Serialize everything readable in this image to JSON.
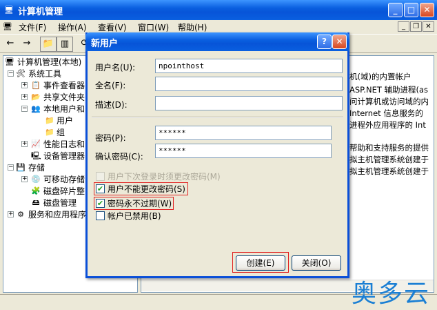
{
  "main_window": {
    "title": "计算机管理",
    "buttons": {
      "minimize": "_",
      "maximize": "□",
      "close": "✕"
    }
  },
  "menu": [
    "文件(F)",
    "操作(A)",
    "查看(V)",
    "窗口(W)",
    "帮助(H)"
  ],
  "mdi_buttons": {
    "minimize": "_",
    "restore": "❐",
    "close": "✕"
  },
  "tree": {
    "root": "计算机管理(本地)",
    "system_tools": "系统工具",
    "event_viewer": "事件查看器",
    "shared_folders": "共享文件夹",
    "local_users": "本地用户和",
    "users": "用户",
    "groups": "组",
    "perf_logs": "性能日志和",
    "device_manager": "设备管理器",
    "storage": "存储",
    "removable": "可移动存储",
    "defrag": "磁盘碎片整",
    "disk_mgmt": "磁盘管理",
    "services": "服务和应用程序"
  },
  "right_pane": {
    "descriptions": [
      "机(域)的内置帐户",
      " ASP.NET 辅助进程(as",
      "问计算机或访问域的内",
      " Internet 信息服务的",
      "进程外应用程序的 Int",
      "帮助和支持服务的提供",
      "拟主机管理系统创建于",
      "拟主机管理系统创建于"
    ]
  },
  "watermark": "奥多云",
  "dialog": {
    "title": "新用户",
    "help_btn": "?",
    "close_btn": "✕",
    "username_label": "用户名(U):",
    "username_value": "npointhost",
    "fullname_label": "全名(F):",
    "fullname_value": "",
    "description_label": "描述(D):",
    "description_value": "",
    "password_label": "密码(P):",
    "password_value": "******",
    "confirm_label": "确认密码(C):",
    "confirm_value": "******",
    "chk_must_change": "用户下次登录时须更改密码(M)",
    "chk_cannot_change": "用户不能更改密码(S)",
    "chk_never_expires": "密码永不过期(W)",
    "chk_disabled": "帐户已禁用(B)",
    "check_mark": "✔",
    "create_btn": "创建(E)",
    "close_button": "关闭(O)"
  },
  "colors": {
    "titlebar": "#0a5fe0",
    "highlight": "#e02020",
    "watermark": "#1a7fd4"
  }
}
